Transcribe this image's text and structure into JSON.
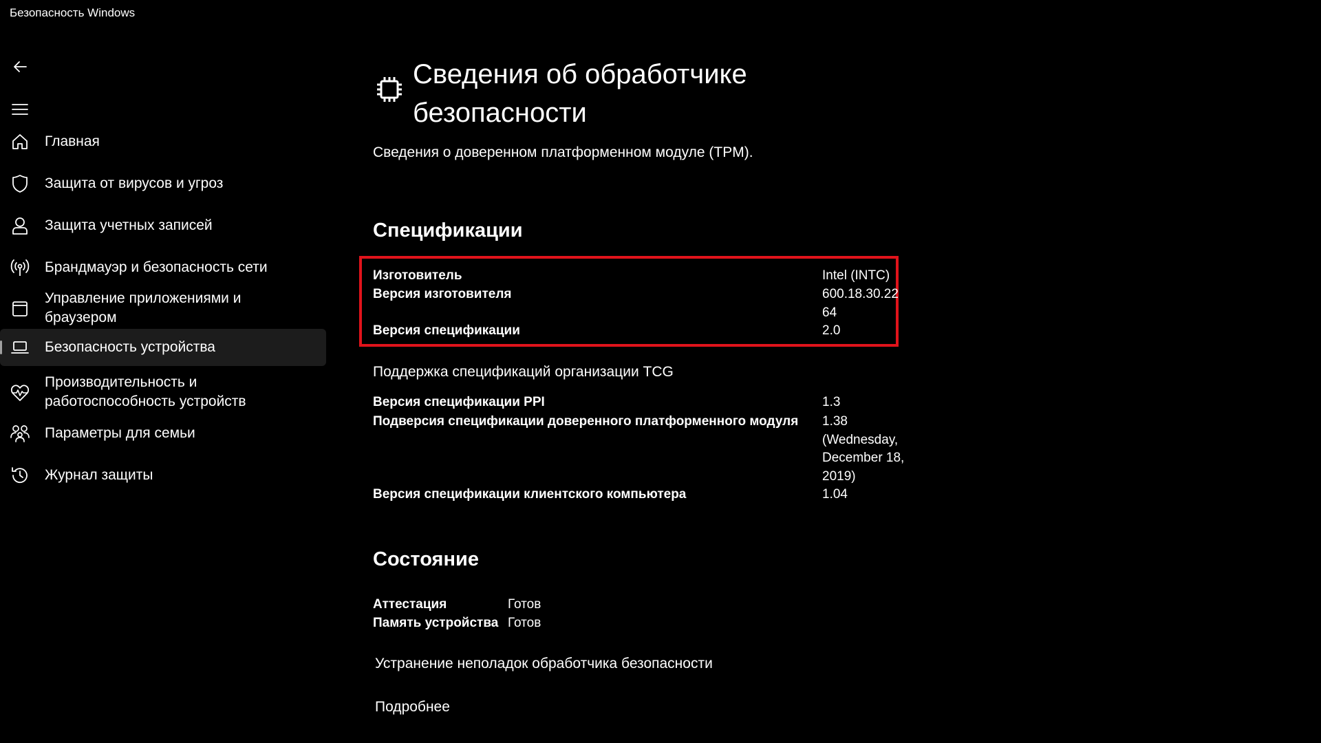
{
  "window": {
    "title": "Безопасность Windows"
  },
  "sidebar": {
    "back_icon": "back-arrow-icon",
    "menu_icon": "hamburger-menu-icon",
    "items": [
      {
        "label": "Главная",
        "icon": "home-icon"
      },
      {
        "label": "Защита от вирусов и угроз",
        "icon": "shield-icon"
      },
      {
        "label": "Защита учетных записей",
        "icon": "person-icon"
      },
      {
        "label": "Брандмауэр и безопасность сети",
        "icon": "wireless-icon"
      },
      {
        "label": "Управление приложениями и\nбраузером",
        "icon": "app-window-icon"
      },
      {
        "label": "Безопасность устройства",
        "icon": "laptop-icon",
        "selected": true
      },
      {
        "label": "Производительность и\nработоспособность устройств",
        "icon": "heart-pulse-icon"
      },
      {
        "label": "Параметры для семьи",
        "icon": "family-icon"
      },
      {
        "label": "Журнал защиты",
        "icon": "history-icon"
      }
    ]
  },
  "main": {
    "page_icon": "processor-chip-icon",
    "title": "Сведения об обработчике безопасности",
    "subtitle": "Сведения о доверенном платформенном модуле (TPM).",
    "specs": {
      "heading": "Спецификации",
      "rows": [
        {
          "key": "Изготовитель",
          "value": "Intel (INTC)"
        },
        {
          "key": "Версия изготовителя",
          "value": "600.18.30.2264"
        },
        {
          "key": "Версия спецификации",
          "value": "2.0"
        }
      ]
    },
    "tcg": {
      "heading": "Поддержка спецификаций организации TCG",
      "rows": [
        {
          "key": "Версия спецификации PPI",
          "value": "1.3"
        },
        {
          "key": "Подверсия спецификации доверенного платформенного модуля",
          "value": "1.38 (Wednesday, December 18, 2019)"
        },
        {
          "key": "Версия спецификации клиентского компьютера",
          "value": "1.04"
        }
      ]
    },
    "status": {
      "heading": "Состояние",
      "rows": [
        {
          "key": "Аттестация",
          "value": "Готов"
        },
        {
          "key": "Память устройства",
          "value": "Готов"
        }
      ]
    },
    "links": {
      "troubleshoot": "Устранение неполадок обработчика безопасности",
      "learn_more": "Подробнее"
    },
    "highlight_color": "#e0131b"
  }
}
